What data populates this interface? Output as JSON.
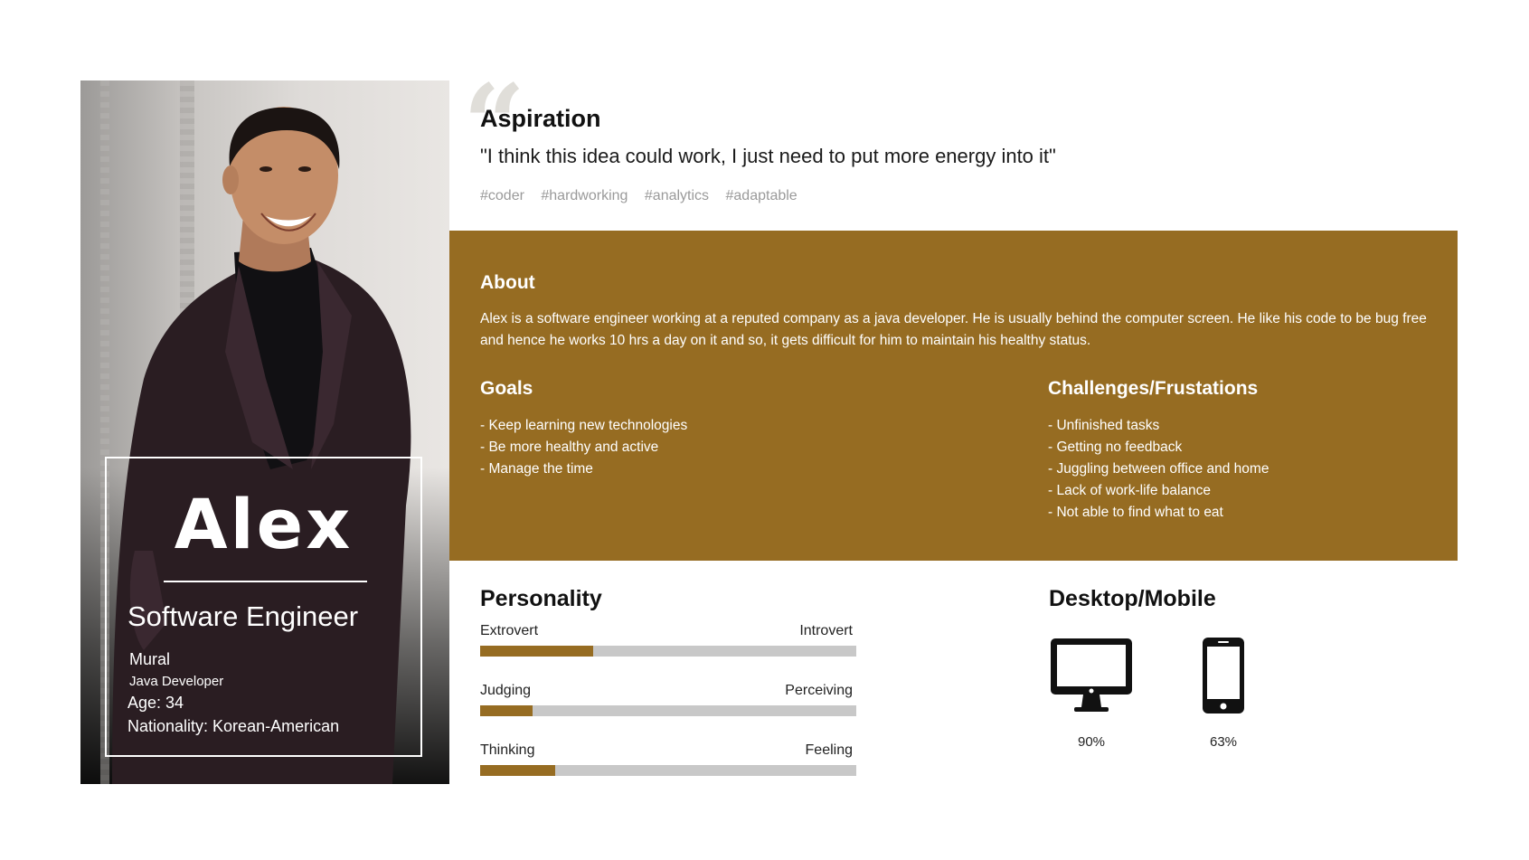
{
  "persona": {
    "name": "Alex",
    "role": "Software Engineer",
    "company": "Mural",
    "position": "Java Developer",
    "age": "Age: 34",
    "nationality": "Nationality: Korean-American"
  },
  "aspiration": {
    "title": "Aspiration",
    "quote": "\"I think this idea could work, I just need to put more energy into it\"",
    "tags": [
      "#coder",
      "#hardworking",
      "#analytics",
      "#adaptable"
    ]
  },
  "about": {
    "title": "About",
    "text": "Alex is a software engineer working at a reputed company as a java developer. He is usually behind the computer screen. He like his code to be bug free and hence he works 10 hrs a day on it and so, it gets difficult for him to maintain his healthy status."
  },
  "goals": {
    "title": "Goals",
    "items": [
      "- Keep learning new technologies",
      "- Be more healthy and active",
      "- Manage the time"
    ]
  },
  "challenges": {
    "title": "Challenges/Frustations",
    "items": [
      "- Unfinished tasks",
      "- Getting no feedback",
      "- Juggling between office and home",
      "- Lack of work-life balance",
      "- Not able to find what to eat"
    ]
  },
  "personality": {
    "title": "Personality",
    "traits": [
      {
        "left": "Extrovert",
        "right": "Introvert",
        "value": 0.3
      },
      {
        "left": "Judging",
        "right": "Perceiving",
        "value": 0.14
      },
      {
        "left": "Thinking",
        "right": "Feeling",
        "value": 0.2
      }
    ]
  },
  "devices": {
    "title": "Desktop/Mobile",
    "desktop": {
      "icon": "desktop-monitor-icon",
      "percent": "90%"
    },
    "mobile": {
      "icon": "mobile-phone-icon",
      "percent": "63%"
    }
  },
  "colors": {
    "accent": "#966c22",
    "track": "#c8c8c8"
  }
}
